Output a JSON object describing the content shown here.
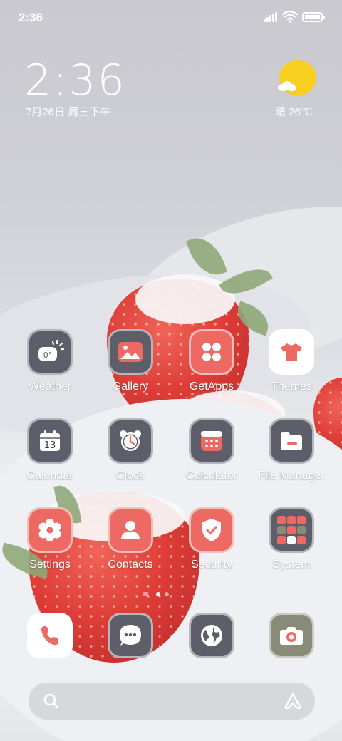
{
  "status_bar": {
    "time": "2:36",
    "icons": [
      "signal-icon",
      "wifi-icon",
      "battery-icon"
    ]
  },
  "clock_widget": {
    "time": "2:36",
    "date": "7月26日 周三下午",
    "weather_icon": "sun-cloud-icon",
    "weather": "晴 26℃"
  },
  "apps": [
    {
      "label": "Weather",
      "icon": "weather-icon",
      "style": "dark"
    },
    {
      "label": "Gallery",
      "icon": "gallery-icon",
      "style": "dark"
    },
    {
      "label": "GetApps",
      "icon": "getapps-icon",
      "style": "red"
    },
    {
      "label": "Themes",
      "icon": "themes-icon",
      "style": "white"
    },
    {
      "label": "Calendar",
      "icon": "calendar-icon",
      "style": "dark",
      "badge": "13"
    },
    {
      "label": "Clock",
      "icon": "clock-icon",
      "style": "dark"
    },
    {
      "label": "Calculator",
      "icon": "calculator-icon",
      "style": "dark"
    },
    {
      "label": "File Manager",
      "icon": "folder-icon",
      "style": "dark"
    },
    {
      "label": "Settings",
      "icon": "gear-icon",
      "style": "red"
    },
    {
      "label": "Contacts",
      "icon": "contacts-icon",
      "style": "red"
    },
    {
      "label": "Security",
      "icon": "shield-icon",
      "style": "red"
    },
    {
      "label": "System",
      "icon": "system-folder-icon",
      "style": "dark"
    }
  ],
  "weather_icon_text": "0°",
  "page_indicator": {
    "current": 2,
    "total": 2
  },
  "dock": [
    {
      "icon": "phone-icon",
      "style": "white"
    },
    {
      "icon": "messages-icon",
      "style": "dark"
    },
    {
      "icon": "browser-icon",
      "style": "dark"
    },
    {
      "icon": "camera-icon",
      "style": "olive"
    }
  ],
  "search_bar": {
    "search_icon": "search-icon",
    "assistant_icon": "assistant-icon"
  },
  "colors": {
    "accent_red": "#ec6a63",
    "tile_dark": "#5d5e69",
    "sun_yellow": "#f7cf20"
  }
}
